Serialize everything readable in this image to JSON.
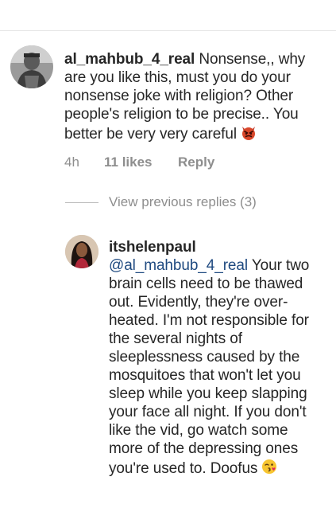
{
  "comment": {
    "username": "al_mahbub_4_real",
    "text": "Nonsense,, why are you like this, must you do your nonsense joke with religion? Other people's religion to be precise.. You better be very very careful",
    "emoji_icon": "angry-devil-emoji-icon",
    "time": "4h",
    "likes": "11 likes",
    "reply_label": "Reply"
  },
  "view_replies": {
    "label": "View previous replies (3)"
  },
  "reply": {
    "username": "itshelenpaul",
    "mention": "@al_mahbub_4_real",
    "text": "Your two brain cells need to be thawed out. Evidently, they're over-heated. I'm not responsible for the several nights of sleeplessness caused by the mosquitoes that won't let you sleep while you keep slapping your face all night. If you don't like the vid, go watch some more of the depressing ones you're used to. Doofus",
    "emoji_icon": "kissing-face-emoji-icon"
  },
  "colors": {
    "text": "#262626",
    "secondary": "#8e8e8e",
    "mention": "#1f4a80",
    "divider": "#e6e6e6"
  }
}
